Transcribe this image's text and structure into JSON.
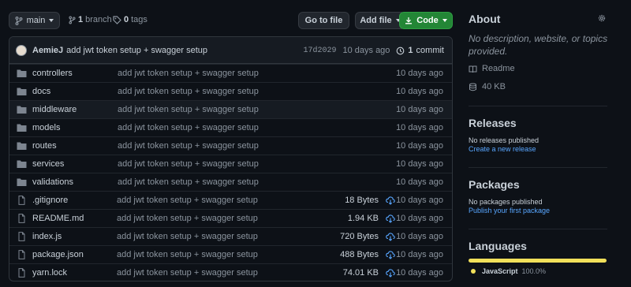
{
  "toolbar": {
    "branch_label": "main",
    "branches_count": "1",
    "branches_label": "branch",
    "tags_count": "0",
    "tags_label": "tags",
    "goto_file_label": "Go to file",
    "add_file_label": "Add file",
    "code_label": "Code"
  },
  "latest_commit": {
    "author": "AemieJ",
    "message": "add jwt token setup + swagger setup",
    "sha": "17d2029",
    "time": "10 days ago",
    "commits_count": "1",
    "commits_label": "commit"
  },
  "files": [
    {
      "name": "controllers",
      "type": "dir",
      "message": "add jwt token setup + swagger setup",
      "size": "",
      "date": "10 days ago"
    },
    {
      "name": "docs",
      "type": "dir",
      "message": "add jwt token setup + swagger setup",
      "size": "",
      "date": "10 days ago"
    },
    {
      "name": "middleware",
      "type": "dir",
      "message": "add jwt token setup + swagger setup",
      "size": "",
      "date": "10 days ago"
    },
    {
      "name": "models",
      "type": "dir",
      "message": "add jwt token setup + swagger setup",
      "size": "",
      "date": "10 days ago"
    },
    {
      "name": "routes",
      "type": "dir",
      "message": "add jwt token setup + swagger setup",
      "size": "",
      "date": "10 days ago"
    },
    {
      "name": "services",
      "type": "dir",
      "message": "add jwt token setup + swagger setup",
      "size": "",
      "date": "10 days ago"
    },
    {
      "name": "validations",
      "type": "dir",
      "message": "add jwt token setup + swagger setup",
      "size": "",
      "date": "10 days ago"
    },
    {
      "name": ".gitignore",
      "type": "file",
      "message": "add jwt token setup + swagger setup",
      "size": "18 Bytes",
      "date": "10 days ago"
    },
    {
      "name": "README.md",
      "type": "file",
      "message": "add jwt token setup + swagger setup",
      "size": "1.94 KB",
      "date": "10 days ago"
    },
    {
      "name": "index.js",
      "type": "file",
      "message": "add jwt token setup + swagger setup",
      "size": "720 Bytes",
      "date": "10 days ago"
    },
    {
      "name": "package.json",
      "type": "file",
      "message": "add jwt token setup + swagger setup",
      "size": "488 Bytes",
      "date": "10 days ago"
    },
    {
      "name": "yarn.lock",
      "type": "file",
      "message": "add jwt token setup + swagger setup",
      "size": "74.01 KB",
      "date": "10 days ago"
    }
  ],
  "sidebar": {
    "about_title": "About",
    "about_description": "No description, website, or topics provided.",
    "readme_label": "Readme",
    "size_label": "40 KB",
    "releases_title": "Releases",
    "releases_note": "No releases published",
    "releases_link": "Create a new release",
    "packages_title": "Packages",
    "packages_note": "No packages published",
    "packages_link": "Publish your first package",
    "languages_title": "Languages",
    "language_name": "JavaScript",
    "language_percent": "100.0%"
  },
  "colors": {
    "background": "#0d1117",
    "accent_green": "#238636",
    "link_blue": "#58a6ff",
    "javascript_yellow": "#f1e05a"
  },
  "icons": {
    "branch": "git-branch-icon",
    "tag": "tag-icon",
    "folder": "folder-icon",
    "file": "file-icon",
    "download": "cloud-download-icon",
    "history": "history-icon",
    "gear": "gear-icon",
    "book": "book-icon",
    "database": "database-icon"
  }
}
